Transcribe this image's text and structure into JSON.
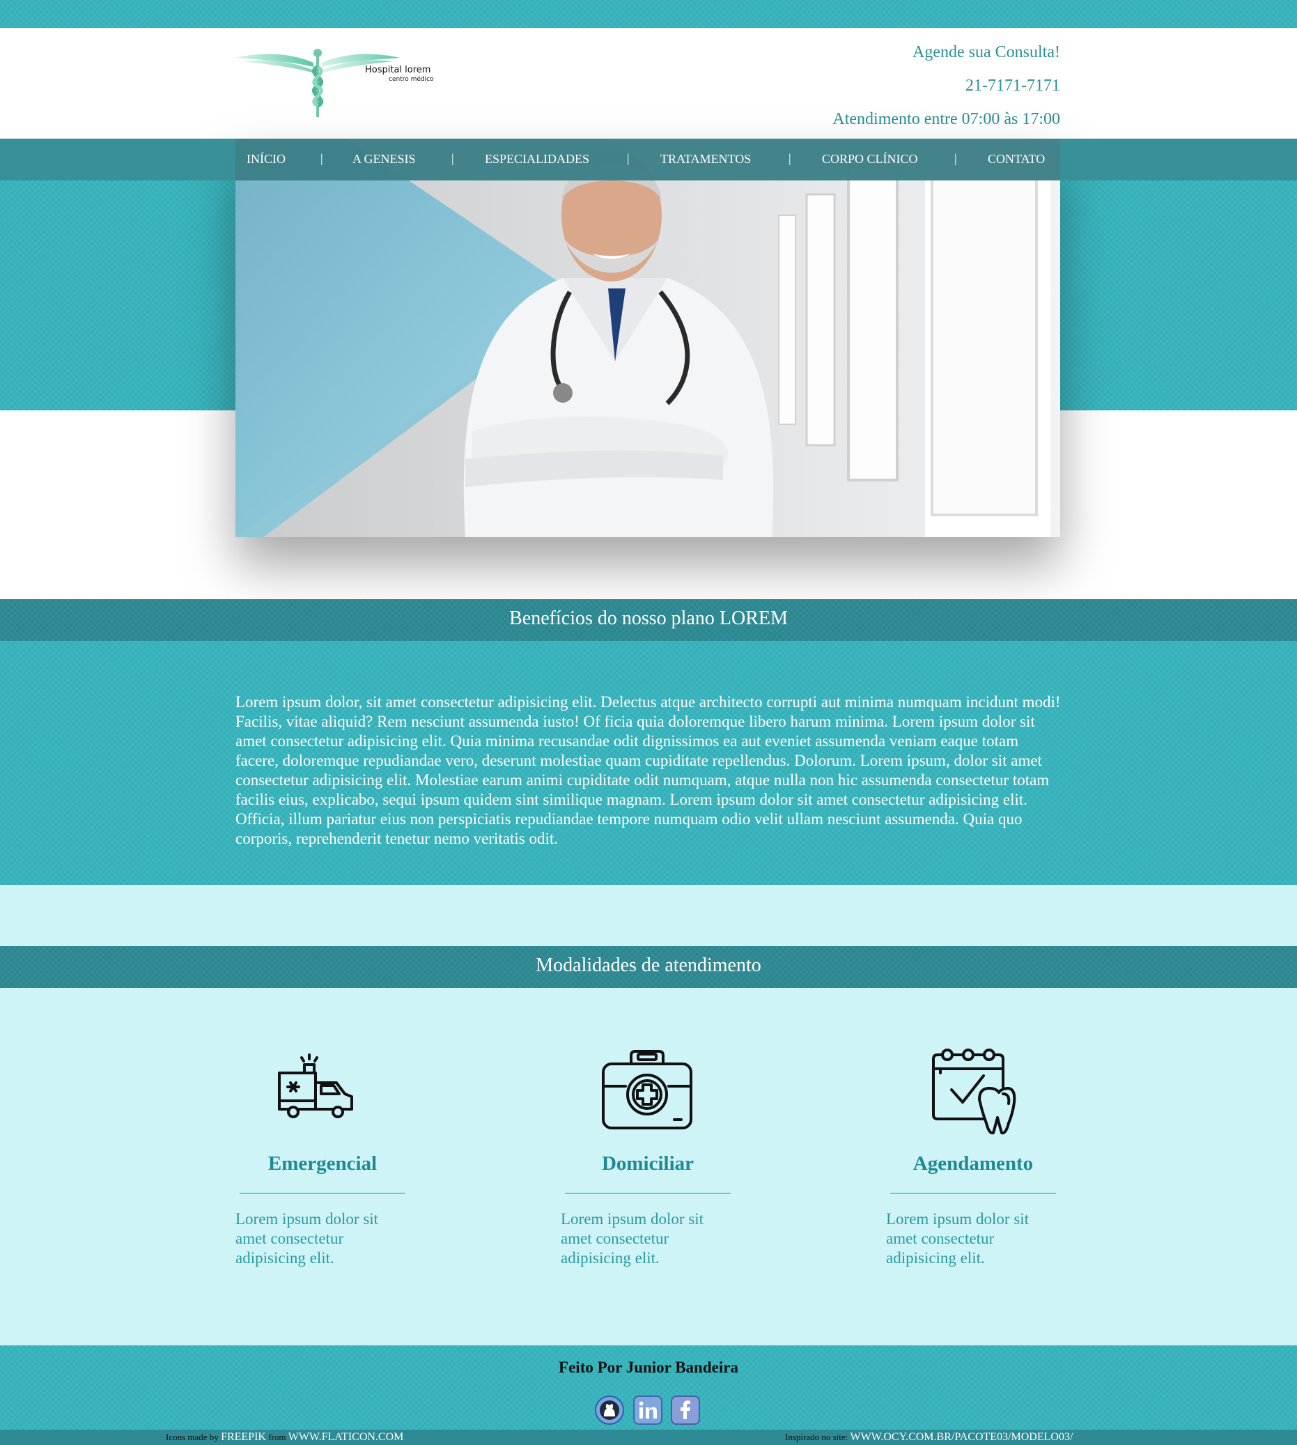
{
  "header": {
    "logo": {
      "name": "Hospital lorem",
      "subtitle": "centro médico"
    },
    "contact": [
      "Agende sua Consulta!",
      "21-7171-7171",
      "Atendimento entre 07:00 às 17:00"
    ]
  },
  "nav": {
    "items": [
      "INÍCIO",
      "A GENESIS",
      "ESPECIALIDADES",
      "TRATAMENTOS",
      "CORPO CLÍNICO",
      "CONTATO"
    ],
    "separator": "|"
  },
  "benefits": {
    "title": "Benefícios do nosso plano LOREM",
    "text": "Lorem ipsum dolor, sit amet consectetur adipisicing elit. Delectus atque architecto corrupti aut minima numquam incidunt modi! Facilis, vitae aliquid? Rem nesciunt assumenda iusto! Of ficia quia doloremque libero harum minima. Lorem ipsum dolor sit amet consectetur adipisicing elit. Quia minima recusandae odit dignissimos ea aut eveniet assumenda veniam eaque totam facere, doloremque repudiandae vero, deserunt molestiae quam cupiditate repellendus. Dolorum. Lorem ipsum, dolor sit amet consectetur adipisicing elit. Molestiae earum animi cupiditate odit numquam, atque nulla non hic assumenda consectetur totam facilis eius, explicabo, sequi ipsum quidem sint similique magnam. Lorem ipsum dolor sit amet consectetur adipisicing elit. Officia, illum pariatur eius non perspiciatis repudiandae tempore numquam odio velit ullam nesciunt assumenda. Quia quo corporis, reprehenderit tenetur nemo veritatis odit."
  },
  "modalities": {
    "title": "Modalidades de atendimento",
    "cards": [
      {
        "icon": "ambulance-icon",
        "title": "Emergencial",
        "text": "Lorem ipsum dolor sit amet consectetur adipisicing elit."
      },
      {
        "icon": "first-aid-kit-icon",
        "title": "Domiciliar",
        "text": "Lorem ipsum dolor sit amet consectetur adipisicing elit."
      },
      {
        "icon": "calendar-tooth-icon",
        "title": "Agendamento",
        "text": "Lorem ipsum dolor sit amet consectetur adipisicing elit."
      }
    ]
  },
  "footer": {
    "credit": "Feito Por Junior Bandeira",
    "social": [
      "github-icon",
      "linkedin-icon",
      "facebook-icon"
    ],
    "icons_note": {
      "prefix": "Icons made by",
      "author": "FREEPIK",
      "mid": "from",
      "site": "WWW.FLATICON.COM"
    },
    "inspired_note": {
      "prefix": "Inspirado no site:",
      "site": "WWW.OCY.COM.BR/PACOTE03/MODELO03/"
    }
  },
  "colors": {
    "teal": "#37b4bd",
    "dark_teal": "#2e8a94",
    "light_cyan": "#cff4f7",
    "text_teal": "#1f8a91"
  }
}
